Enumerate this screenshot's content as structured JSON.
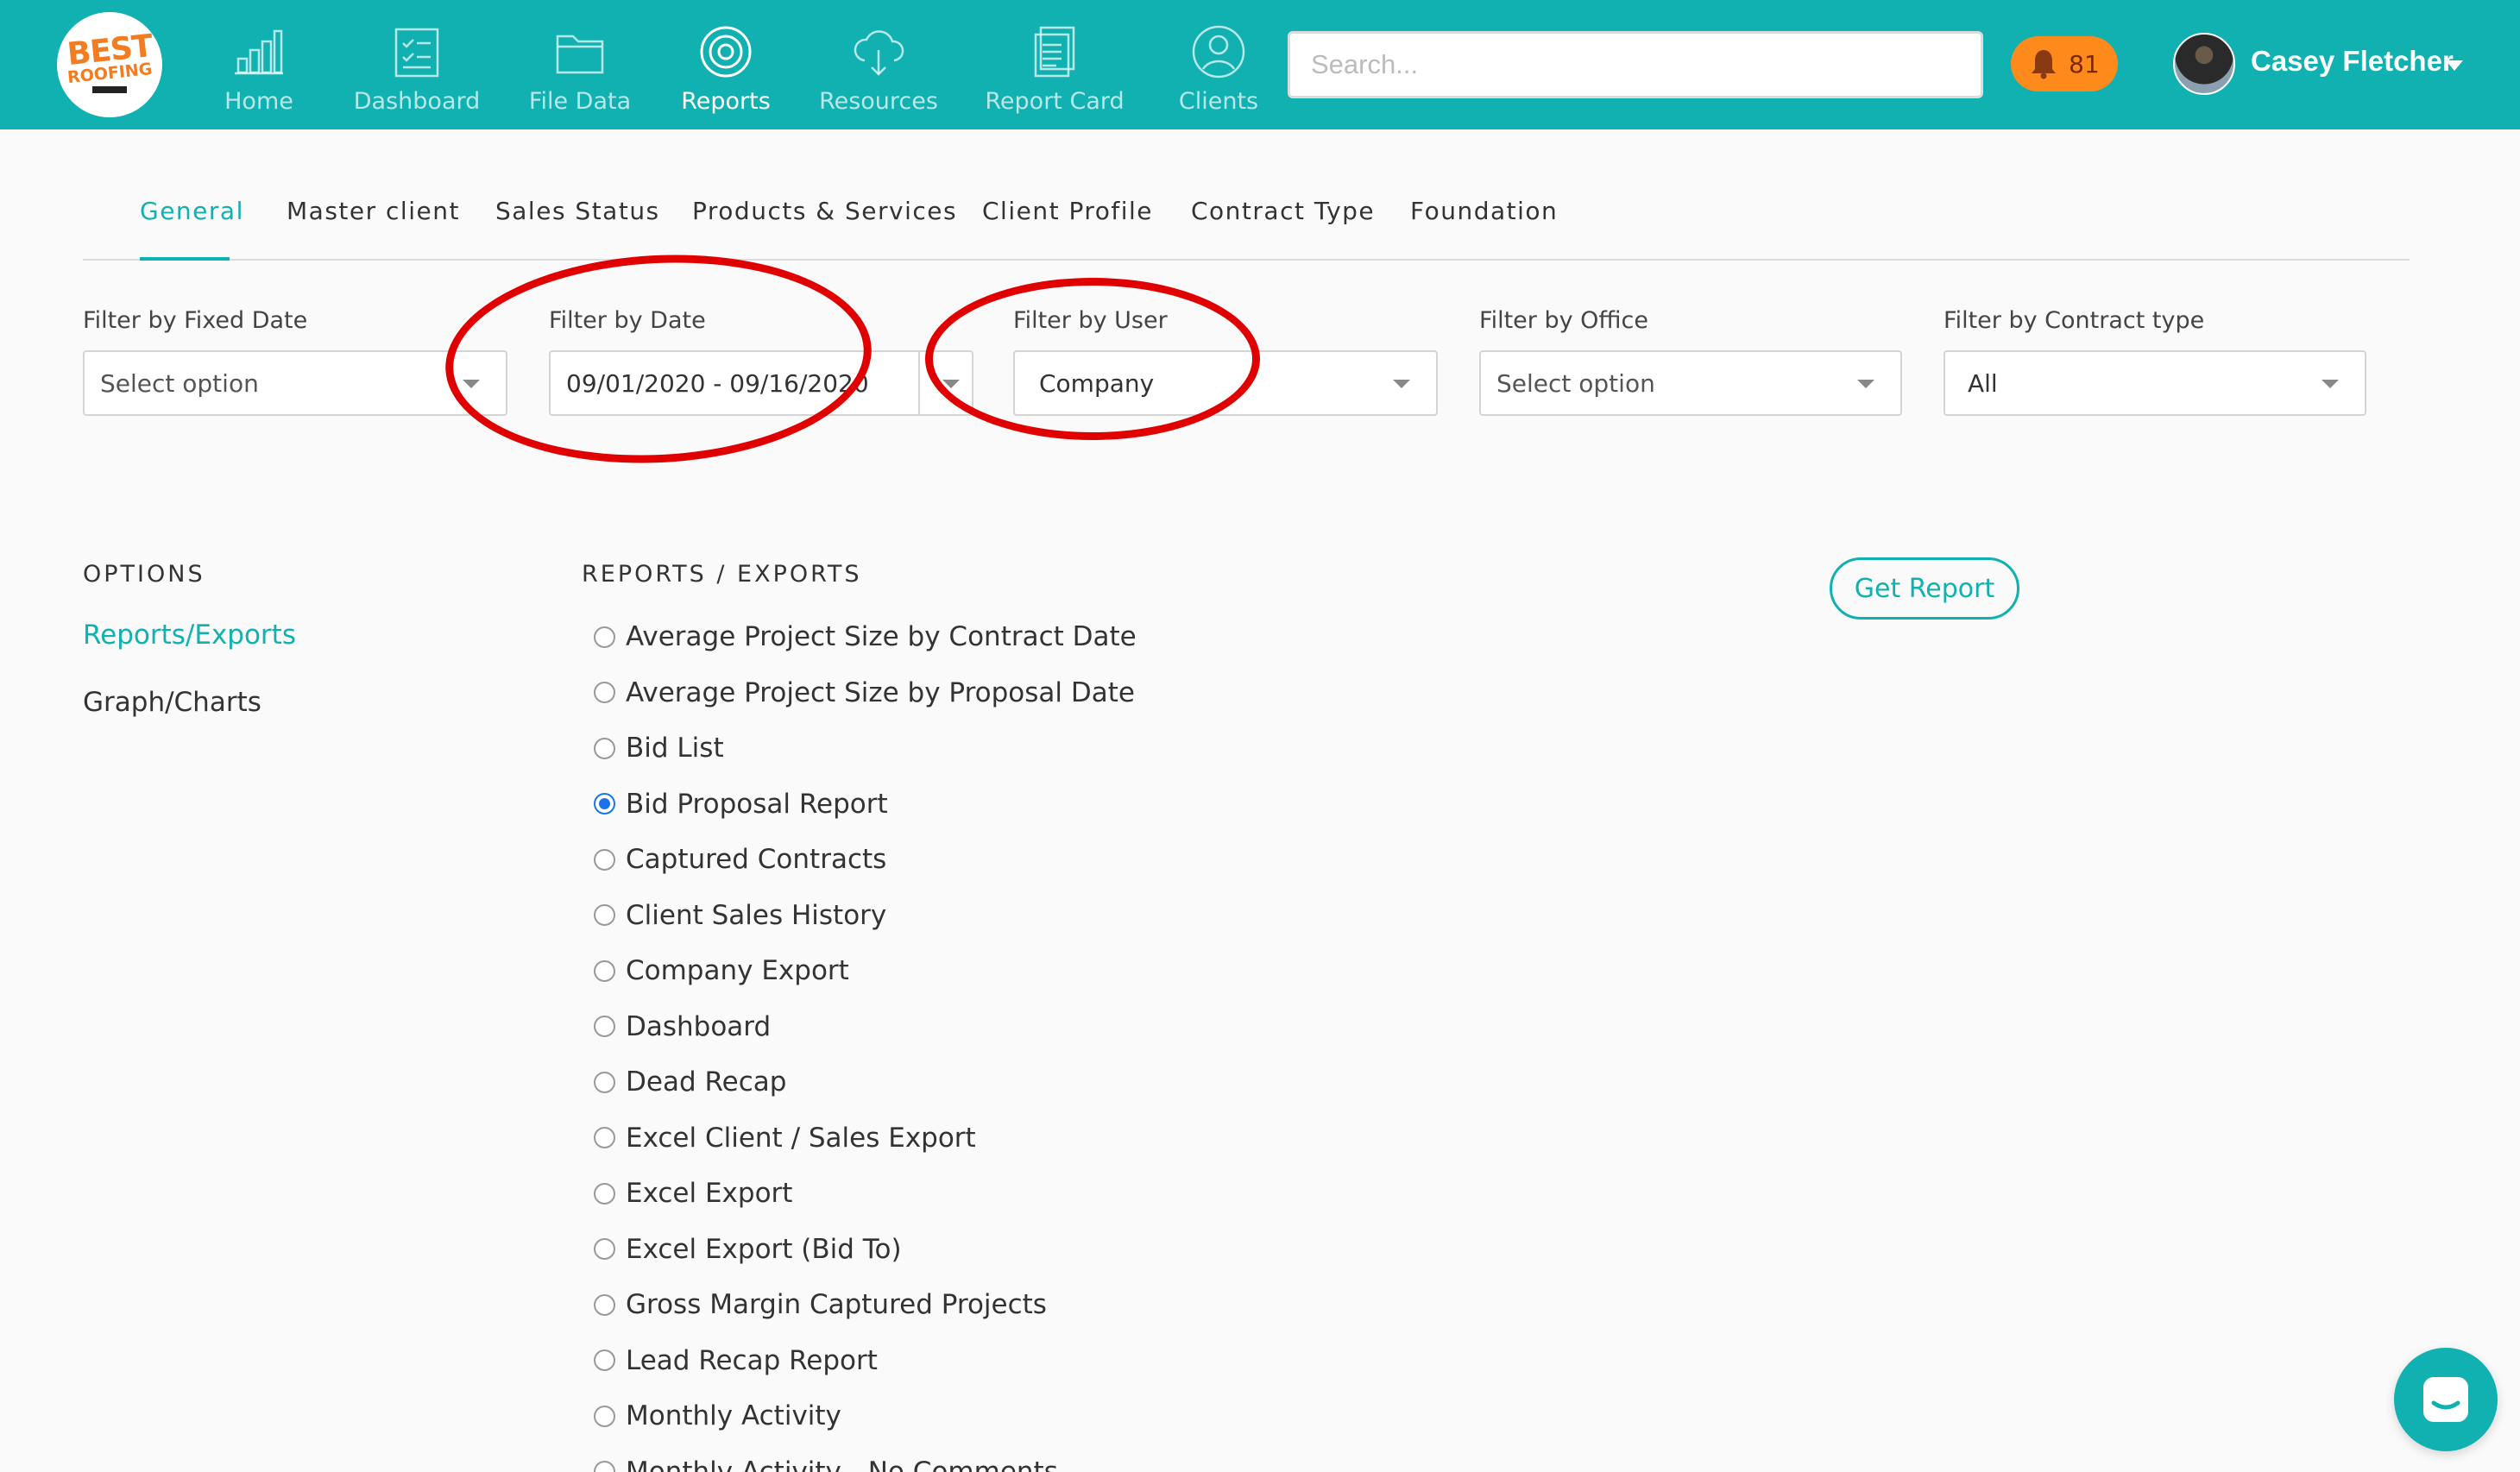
{
  "header": {
    "logo_line1": "BEST",
    "logo_line2": "ROOFING",
    "nav": [
      {
        "label": "Home",
        "icon": "bar-chart-icon"
      },
      {
        "label": "Dashboard",
        "icon": "clipboard-check-icon"
      },
      {
        "label": "File Data",
        "icon": "folder-icon"
      },
      {
        "label": "Reports",
        "icon": "target-icon"
      },
      {
        "label": "Resources",
        "icon": "cloud-download-icon"
      },
      {
        "label": "Report Card",
        "icon": "document-stack-icon"
      },
      {
        "label": "Clients",
        "icon": "user-circle-icon"
      }
    ],
    "active_nav": "Reports",
    "search_placeholder": "Search...",
    "notification_count": "81",
    "user_name": "Casey Fletcher"
  },
  "tabs": {
    "items": [
      "General",
      "Master client",
      "Sales Status",
      "Products & Services",
      "Client Profile",
      "Contract Type",
      "Foundation"
    ],
    "active": "General"
  },
  "filters": {
    "fixed_date": {
      "label": "Filter by Fixed Date",
      "value": "Select option"
    },
    "date": {
      "label": "Filter by Date",
      "value": "09/01/2020 - 09/16/2020"
    },
    "user": {
      "label": "Filter by User",
      "value": "Company"
    },
    "office": {
      "label": "Filter by Office",
      "value": "Select option"
    },
    "contract_type": {
      "label": "Filter by Contract type",
      "value": "All"
    }
  },
  "options": {
    "heading": "OPTIONS",
    "items": [
      "Reports/Exports",
      "Graph/Charts"
    ],
    "active": "Reports/Exports"
  },
  "reports": {
    "heading": "REPORTS / EXPORTS",
    "items": [
      "Average Project Size by Contract Date",
      "Average Project Size by Proposal Date",
      "Bid List",
      "Bid Proposal Report",
      "Captured Contracts",
      "Client Sales History",
      "Company Export",
      "Dashboard",
      "Dead Recap",
      "Excel Client / Sales Export",
      "Excel Export",
      "Excel Export (Bid To)",
      "Gross Margin Captured Projects",
      "Lead Recap Report",
      "Monthly Activity",
      "Monthly Activity - No Comments"
    ],
    "selected": "Bid Proposal Report"
  },
  "actions": {
    "get_report": "Get Report"
  },
  "colors": {
    "brand": "#10b1b0",
    "annotation": "#e00000",
    "notification": "#ff8a1c",
    "radio_selected": "#1a73e8"
  }
}
